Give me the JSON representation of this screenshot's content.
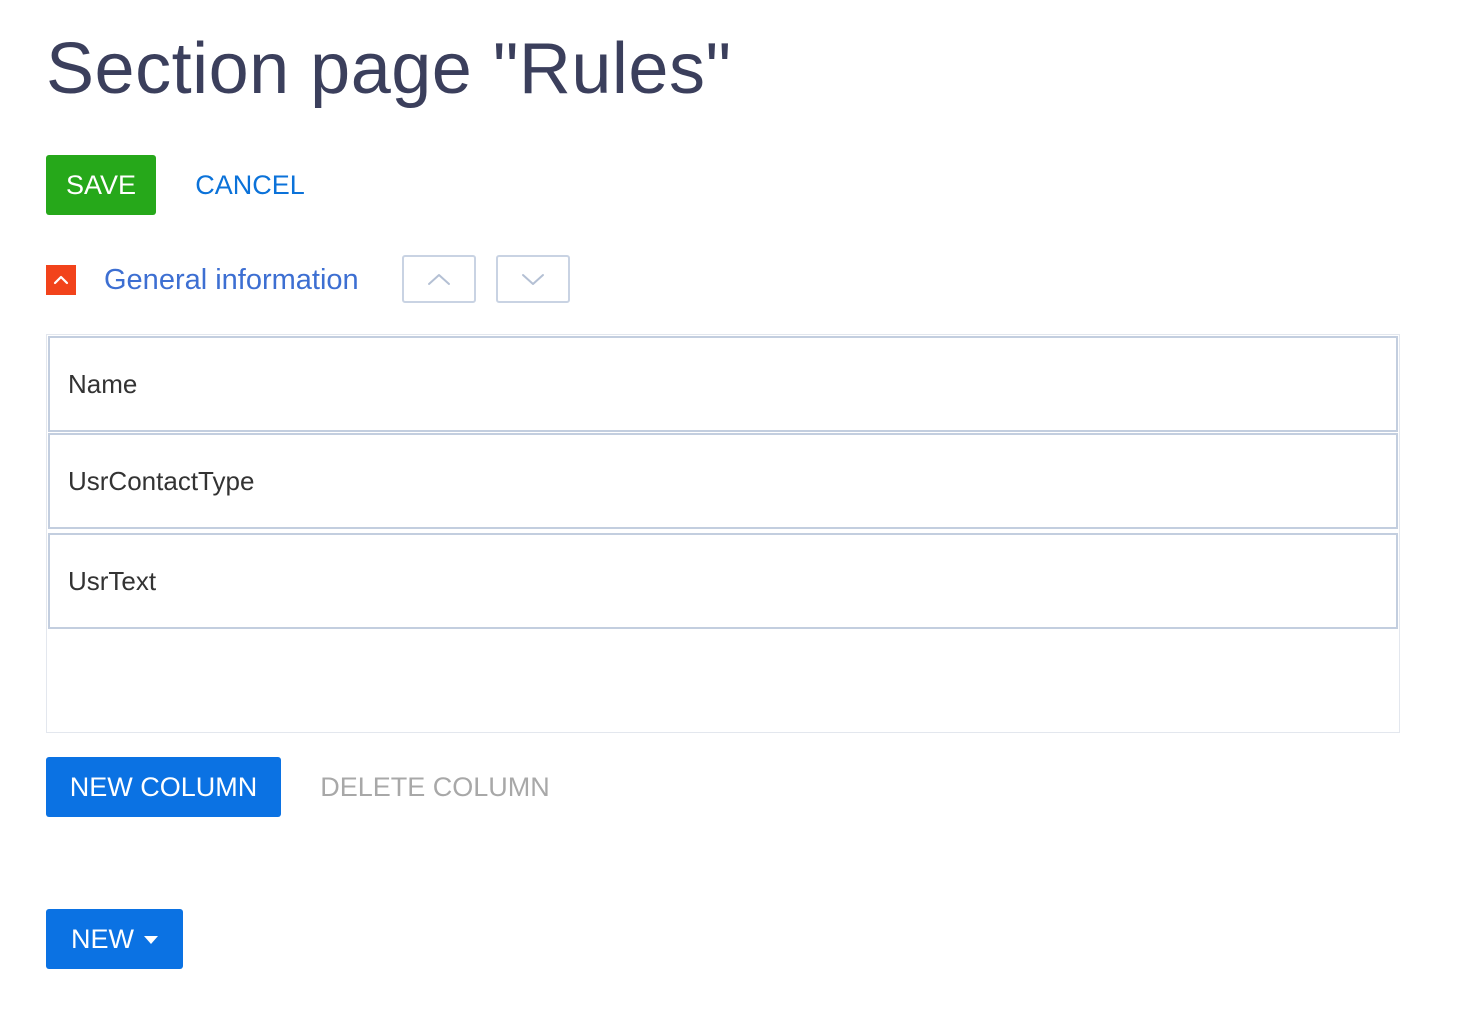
{
  "page": {
    "title": "Section page \"Rules\""
  },
  "toolbar": {
    "save_label": "SAVE",
    "cancel_label": "CANCEL"
  },
  "section": {
    "title": "General information",
    "toggle_icon": "chevron-up-icon",
    "move_up_icon": "chevron-up-icon",
    "move_down_icon": "chevron-down-icon",
    "toggle_color": "#f2431b"
  },
  "grid": {
    "rows": [
      {
        "label": "Name"
      },
      {
        "label": "UsrContactType"
      },
      {
        "label": "UsrText"
      }
    ]
  },
  "column_actions": {
    "new_column_label": "NEW COLUMN",
    "delete_column_label": "DELETE COLUMN",
    "delete_column_disabled": true
  },
  "bottom": {
    "new_label": "NEW",
    "new_icon": "caret-down-icon"
  },
  "colors": {
    "save": "#26a81a",
    "primary": "#0b72e3",
    "link": "#0b72d9",
    "title": "#3b3f5c",
    "section_title": "#3d6fd2",
    "disabled": "#a8a8a8"
  }
}
